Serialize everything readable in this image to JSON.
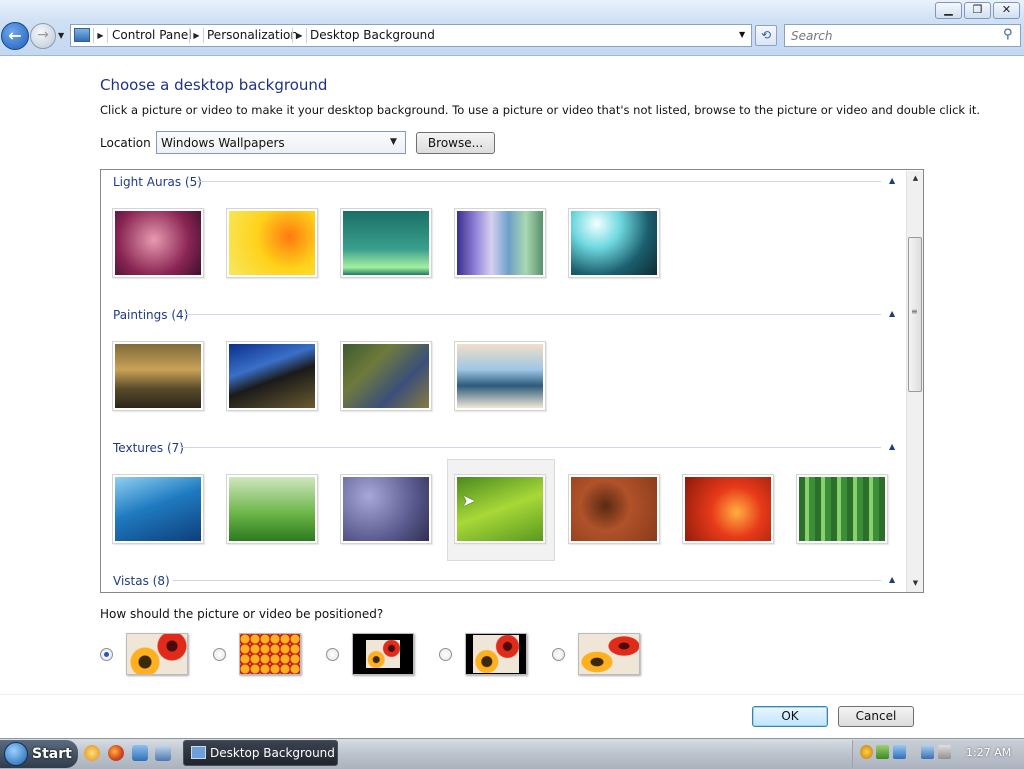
{
  "window": {
    "address_crumbs": [
      "Control Panel",
      "Personalization",
      "Desktop Background"
    ],
    "search_placeholder": "Search"
  },
  "content": {
    "heading": "Choose a desktop background",
    "instructions": "Click a picture or video to make it your desktop background. To use a picture or video that's not listed, browse to the picture or video and double click it.",
    "location_label": "Location",
    "location_value": "Windows Wallpapers",
    "browse_label": "Browse...",
    "groups": [
      {
        "label": "Light Auras (5)",
        "thumbs": [
          "radial-gradient(circle at 45% 45%,#e79bb0,#8a2553 60%,#3d0f2e)",
          "radial-gradient(circle at 70% 40%,#ff7a10,#ffd21a 45%,#f7e860)",
          "linear-gradient(180deg,#1a6f66,#3aa08d 60%,#a5f0a0 88%,#1d7a61)",
          "linear-gradient(90deg,#3a2f8c,#8a7cd6,#d6d0f0,#6d9fc9,#a8d8b0,#5a8f6d)",
          "radial-gradient(circle at 30% 20%,#f4ffff,#6fd9e0 30%,#1b5f6e 65%,#0d2a34)"
        ]
      },
      {
        "label": "Paintings (4)",
        "thumbs": [
          "linear-gradient(180deg,#7e6b3c,#c9a257 40%,#5a4a2a 70%,#2c2618)",
          "linear-gradient(160deg,#0a2f8a,#3a70c8 35%,#1a1a1a 55%,#6b5a30)",
          "linear-gradient(135deg,#3c5a2f,#6f7a3c,#3a4f7a,#8a7a40)",
          "linear-gradient(180deg,#f0e0c8,#9ec6e6 40%,#2c5a7a 65%,#f0e8d8)"
        ]
      },
      {
        "label": "Textures (7)",
        "thumbs": [
          "linear-gradient(160deg,#8fd0f0,#1f7ac0 45%,#0d3f7a)",
          "linear-gradient(180deg,#cfe6c0,#6fb84a 55%,#2c7a1f)",
          "radial-gradient(circle at 30% 30%,#a8a8d8,#5a5a8f 60%,#2f2f50)",
          "linear-gradient(160deg,#4a8a1f,#a8d838 50%,#5a9a20)",
          "radial-gradient(circle at 40% 45%,#5a2a12,#b0522a 40%,#8a3a1a)",
          "radial-gradient(circle at 60% 55%,#ffb040,#e83a1a 40%,#8a1a0a)",
          "repeating-linear-gradient(90deg,#2c6f2a 0 6px,#8ad06a 6px 10px,#3c8f3a 10px 16px)"
        ]
      },
      {
        "label": "Vistas (8)",
        "thumbs": []
      }
    ],
    "position_question": "How should the picture or video be positioned?",
    "ok_label": "OK",
    "cancel_label": "Cancel"
  },
  "taskbar": {
    "start_label": "Start",
    "task_label": "Desktop Background",
    "clock": "1:27 AM"
  },
  "colors": {
    "heading": "#1e3287",
    "group_label": "#1e3a8a",
    "selected_radio": "#2557b8"
  }
}
